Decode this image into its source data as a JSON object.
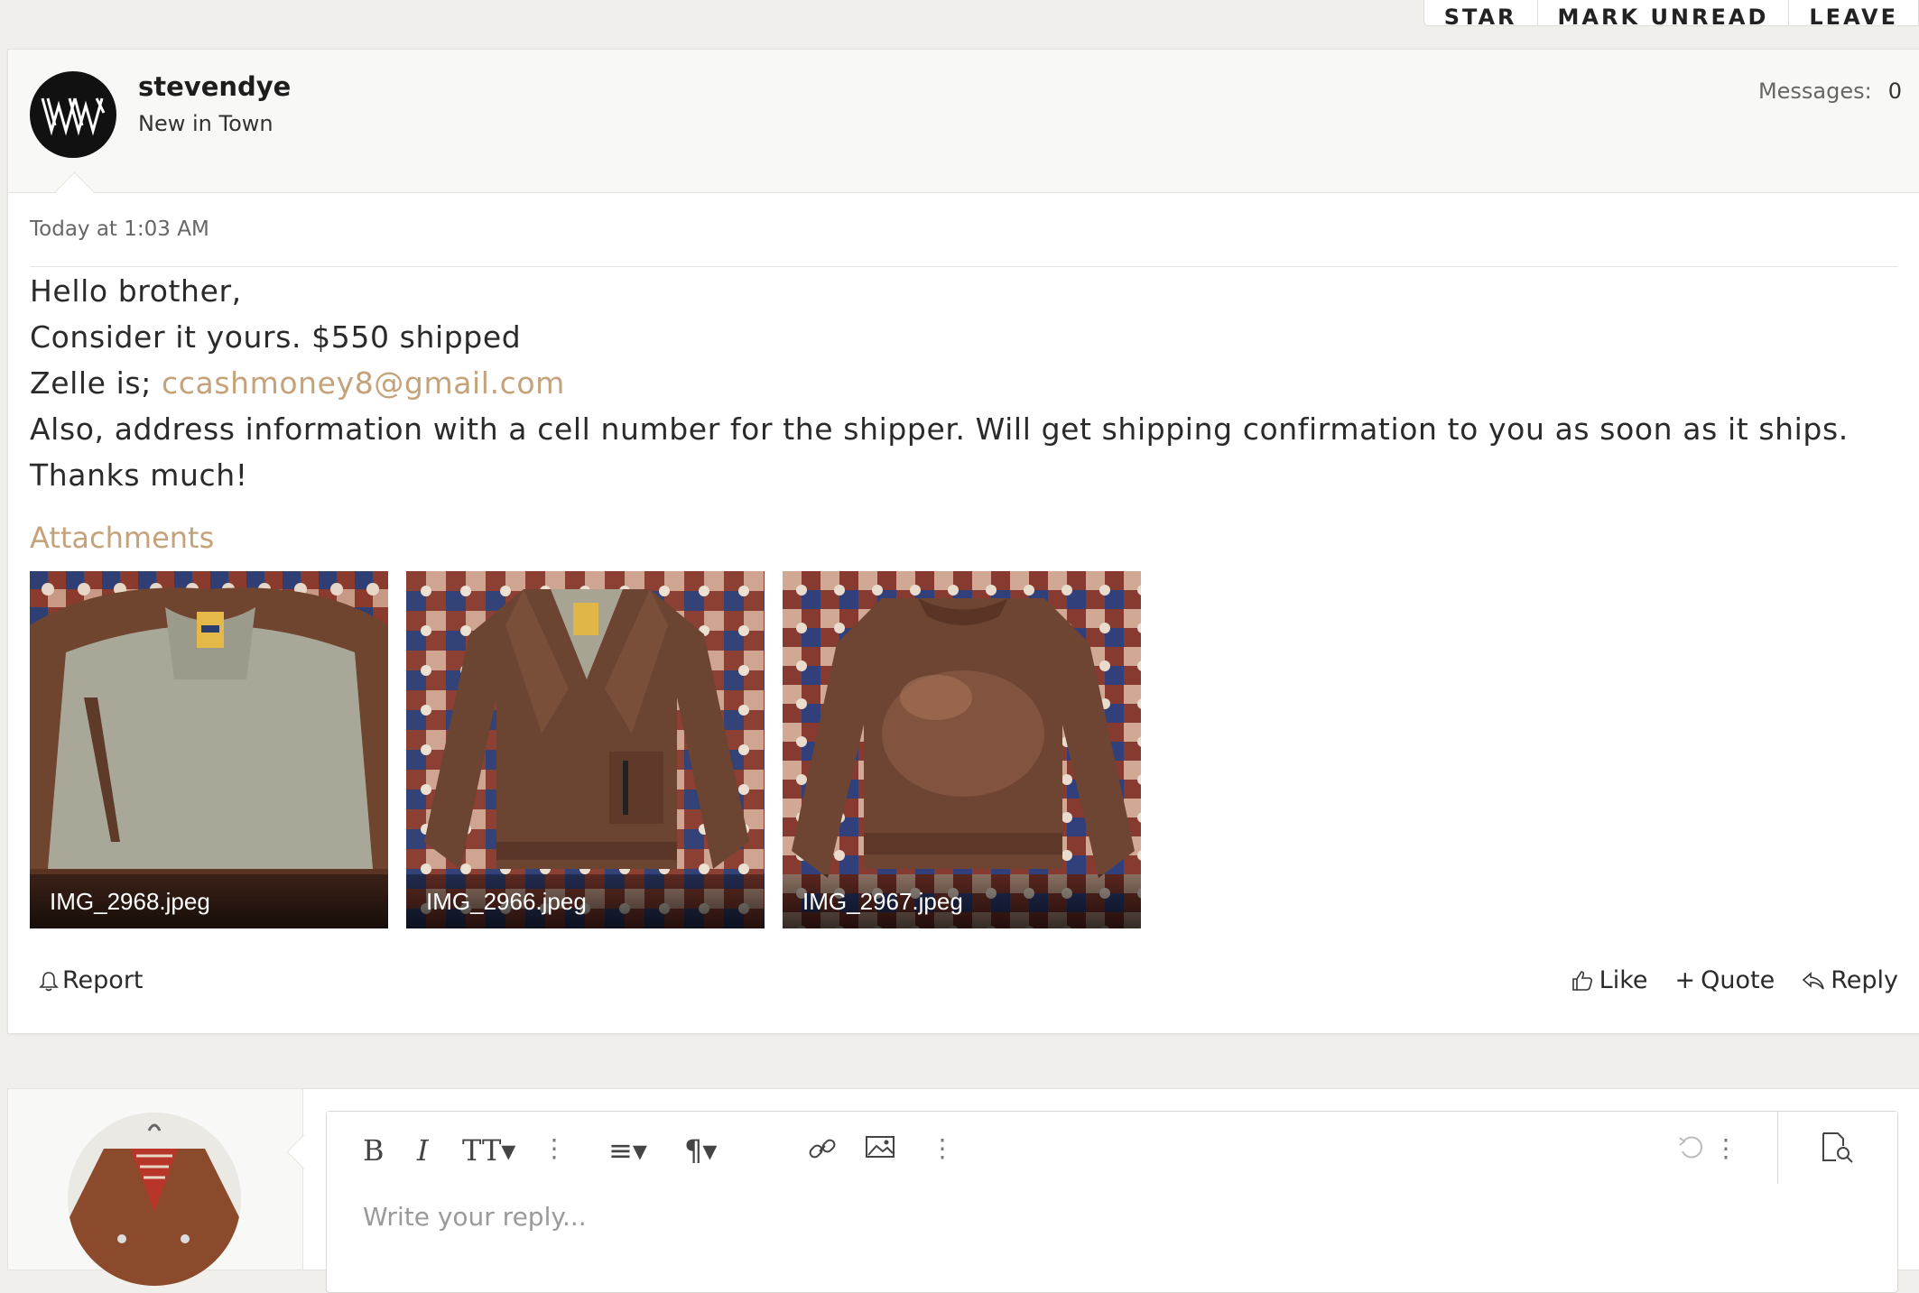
{
  "top_actions": [
    "STAR",
    "MARK UNREAD",
    "LEAVE"
  ],
  "author": {
    "username": "stevendye",
    "title": "New in Town",
    "messages_label": "Messages:",
    "messages_count": "0"
  },
  "post": {
    "timestamp": "Today at 1:03 AM",
    "lines": [
      "Hello brother,",
      "Consider it yours. $550 shipped"
    ],
    "zelle_prefix": "Zelle is; ",
    "zelle_email": "ccashmoney8@gmail.com",
    "last_line": "Also, address information with a cell number for the shipper. Will get shipping confirmation to you as soon as it ships. Thanks much!"
  },
  "attachments": {
    "title": "Attachments",
    "files": [
      "IMG_2968.jpeg",
      "IMG_2966.jpeg",
      "IMG_2967.jpeg"
    ]
  },
  "footer": {
    "report": "Report",
    "like": "Like",
    "quote": "Quote",
    "reply": "Reply"
  },
  "editor": {
    "placeholder": "Write your reply..."
  },
  "colors": {
    "accent": "#c4a27a",
    "background": "#f0efeb"
  }
}
